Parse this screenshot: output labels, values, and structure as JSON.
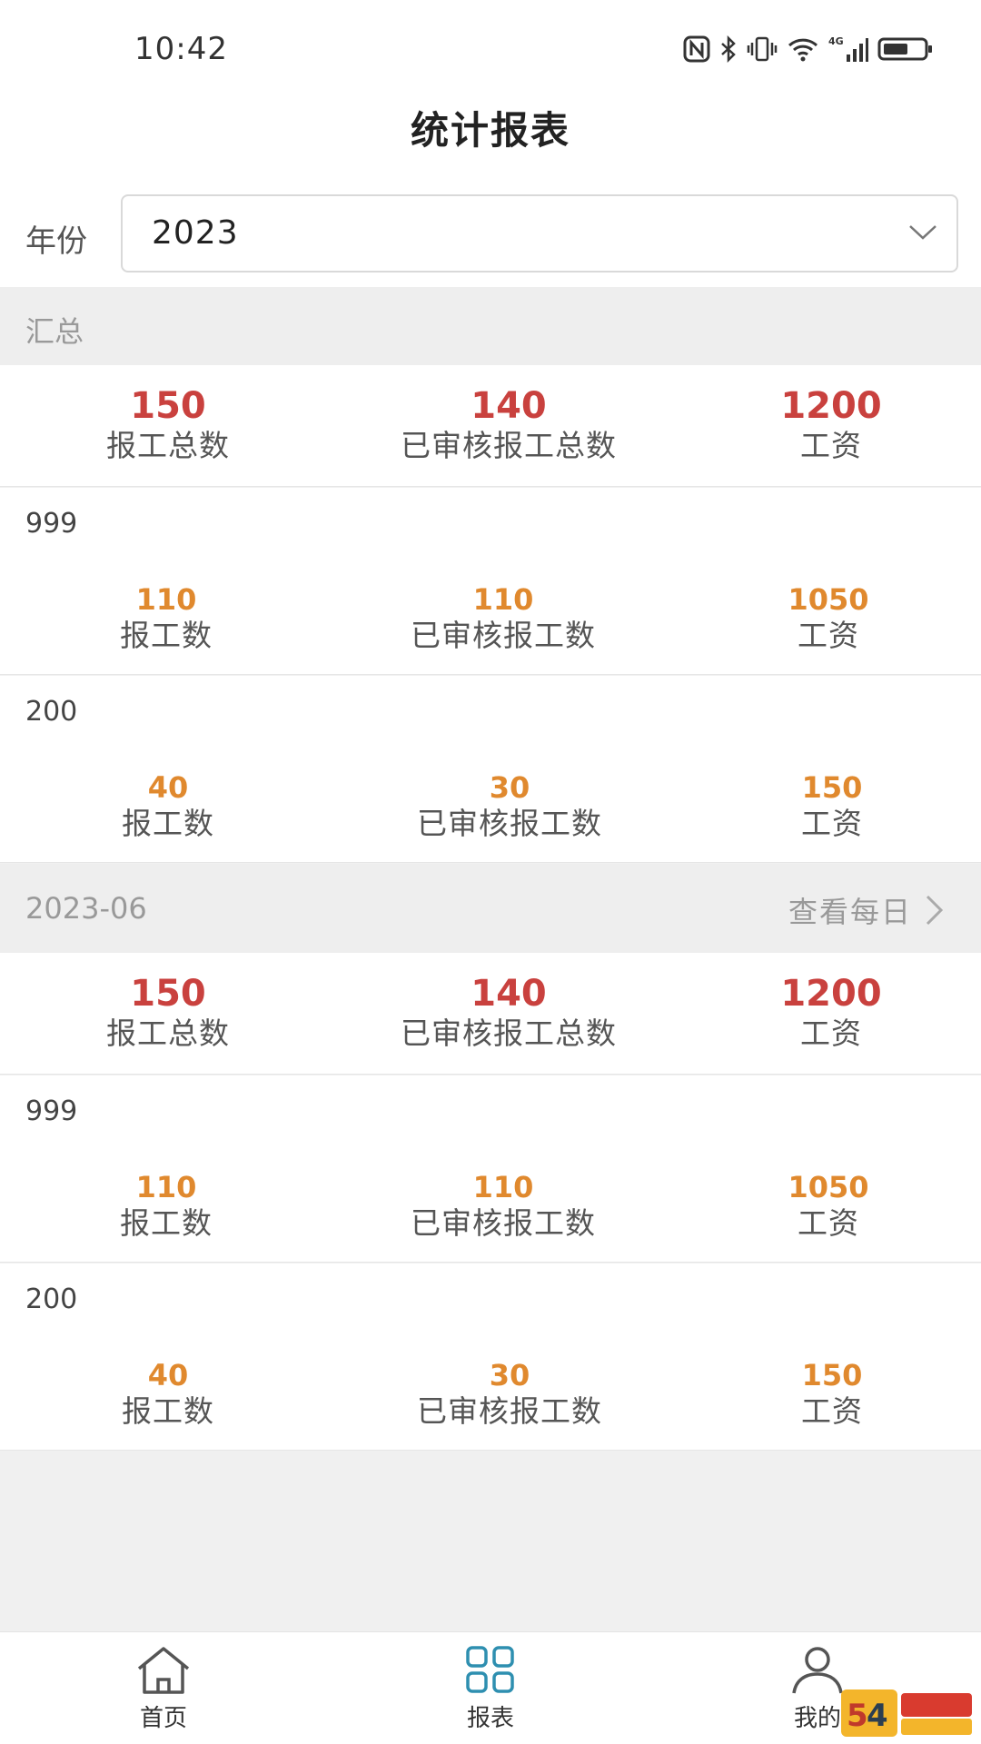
{
  "status_bar": {
    "time": "10:42",
    "network": "4G"
  },
  "nav": {
    "title": "统计报表"
  },
  "filter": {
    "year_label": "年份",
    "year_value": "2023"
  },
  "labels": {
    "total_reports": "报工总数",
    "approved_total": "已审核报工总数",
    "wage": "工资",
    "reports": "报工数",
    "approved": "已审核报工数"
  },
  "sections": [
    {
      "title": "汇总",
      "summary": {
        "total_reports": "150",
        "approved_total": "140",
        "wage": "1200"
      },
      "items": [
        {
          "name": "999",
          "reports": "110",
          "approved": "110",
          "wage": "1050"
        },
        {
          "name": "200",
          "reports": "40",
          "approved": "30",
          "wage": "150"
        }
      ]
    },
    {
      "title": "2023-06",
      "link": "查看每日",
      "summary": {
        "total_reports": "150",
        "approved_total": "140",
        "wage": "1200"
      },
      "items": [
        {
          "name": "999",
          "reports": "110",
          "approved": "110",
          "wage": "1050"
        },
        {
          "name": "200",
          "reports": "40",
          "approved": "30",
          "wage": "150"
        }
      ]
    }
  ],
  "tabs": [
    {
      "label": "首页",
      "icon": "home-icon"
    },
    {
      "label": "报表",
      "icon": "grid-icon",
      "active": true
    },
    {
      "label": "我的",
      "icon": "user-icon"
    }
  ],
  "colors": {
    "accent_red": "#c9413e",
    "accent_orange": "#e0892e",
    "tab_active": "#2e8fb0"
  }
}
